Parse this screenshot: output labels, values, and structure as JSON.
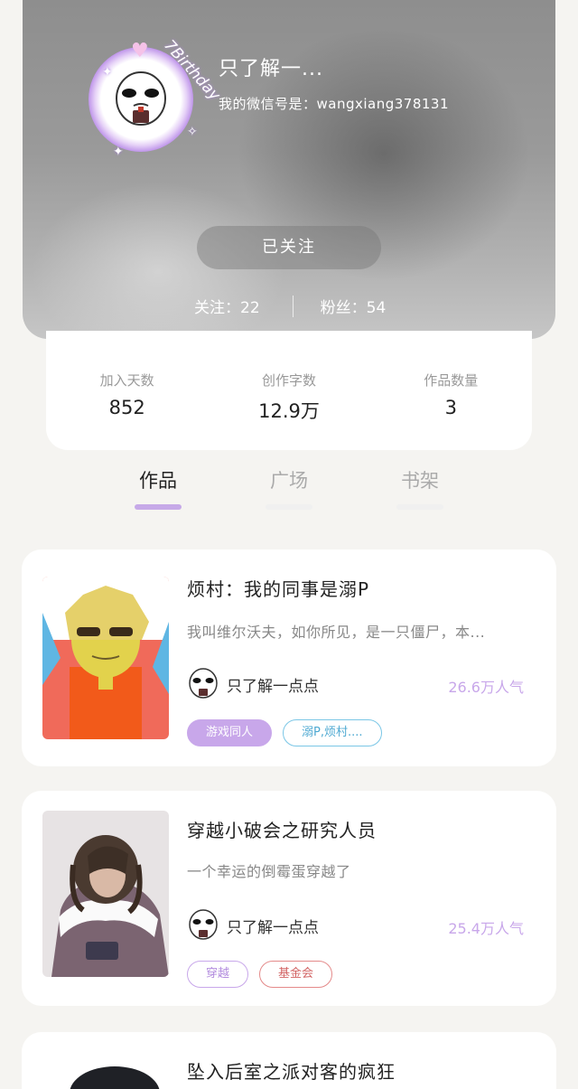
{
  "profile": {
    "avatar_badge": "7Birthday",
    "username": "只了解一...",
    "wechat": "我的微信号是：wangxiang378131",
    "follow_button": "已关注",
    "following": "关注：22",
    "followers": "粉丝：54"
  },
  "stats": [
    {
      "label": "加入天数",
      "value": "852"
    },
    {
      "label": "创作字数",
      "value": "12.9万"
    },
    {
      "label": "作品数量",
      "value": "3"
    }
  ],
  "tabs": [
    {
      "label": "作品",
      "active": true
    },
    {
      "label": "广场",
      "active": false
    },
    {
      "label": "书架",
      "active": false
    }
  ],
  "works": [
    {
      "title": "烦村：我的同事是溺P",
      "desc": "我叫维尔沃夫，如你所见，是一只僵尸，本...",
      "author": "只了解一点点",
      "popularity": "26.6万人气",
      "tags": [
        {
          "label": "游戏同人",
          "style": "fill"
        },
        {
          "label": "溺P,烦村....",
          "style": "blue"
        }
      ]
    },
    {
      "title": "穿越小破会之研究人员",
      "desc": "一个幸运的倒霉蛋穿越了",
      "author": "只了解一点点",
      "popularity": "25.4万人气",
      "tags": [
        {
          "label": "穿越",
          "style": "purple"
        },
        {
          "label": "基金会",
          "style": "red"
        }
      ]
    },
    {
      "title": "坠入后室之派对客的疯狂"
    }
  ],
  "colors": {
    "accent": "#c8a7ea",
    "background": "#f5f4f1"
  }
}
